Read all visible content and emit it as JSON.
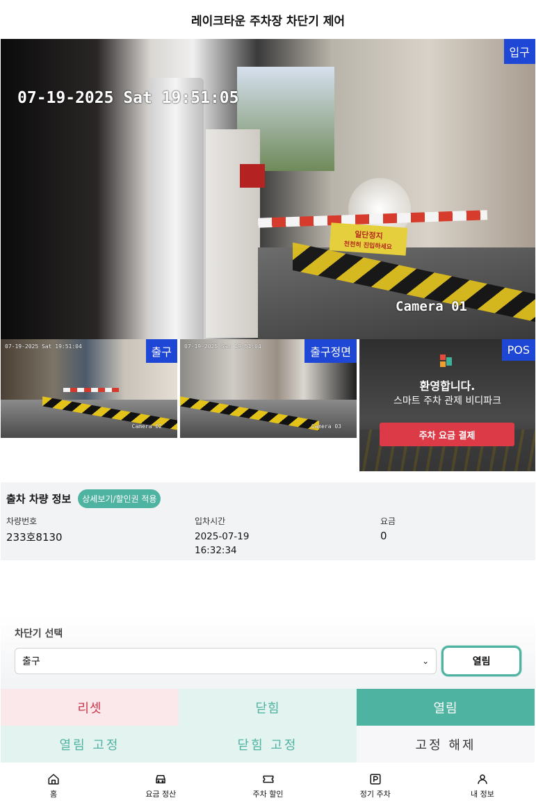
{
  "header": {
    "title": "레이크타운 주차장 차단기 제어"
  },
  "main_camera": {
    "tag": "입구",
    "osd_time": "07-19-2025 Sat 19:51:05",
    "osd_camera": "Camera 01",
    "sign_line1": "일단정지",
    "sign_line2": "천천히 진입하세요"
  },
  "thumbs": [
    {
      "tag": "출구",
      "osd_time": "07-19-2025 Sat 19:51:04",
      "osd_camera": "Camera 02"
    },
    {
      "tag": "출구정면",
      "osd_time": "07-19-2025 Sat 19:51:04",
      "osd_camera": "Camera 03"
    }
  ],
  "pos": {
    "tag": "POS",
    "welcome": "환영합니다.",
    "subtitle": "스마트 주차 관제 비디파크",
    "pay_button": "주차 요금 결제"
  },
  "exit_info": {
    "title": "출차 차량 정보",
    "detail_button": "상세보기/할인권 적용",
    "plate_label": "차량번호",
    "plate_value": "233호8130",
    "entry_label": "입차시간",
    "entry_value": "2025-07-19 16:32:34",
    "fee_label": "요금",
    "fee_value": "0"
  },
  "gate_select": {
    "label": "차단기 선택",
    "selected": "출구",
    "open_button": "열림"
  },
  "controls": {
    "reset": "리셋",
    "close": "닫힘",
    "open": "열림",
    "open_fixed": "열림 고정",
    "close_fixed": "닫힘 고정",
    "release_fixed": "고정 해제"
  },
  "bottom_nav": [
    {
      "label": "홈",
      "icon": "home-icon"
    },
    {
      "label": "요금 정산",
      "icon": "car-icon"
    },
    {
      "label": "주차 할인",
      "icon": "ticket-icon"
    },
    {
      "label": "정기 주차",
      "icon": "parking-icon"
    },
    {
      "label": "내 정보",
      "icon": "user-icon"
    }
  ],
  "colors": {
    "accent": "#4fb3a1",
    "camera_tag": "#1f47d6",
    "reset_text": "#d0364a",
    "pos_button": "#dc3a47"
  }
}
